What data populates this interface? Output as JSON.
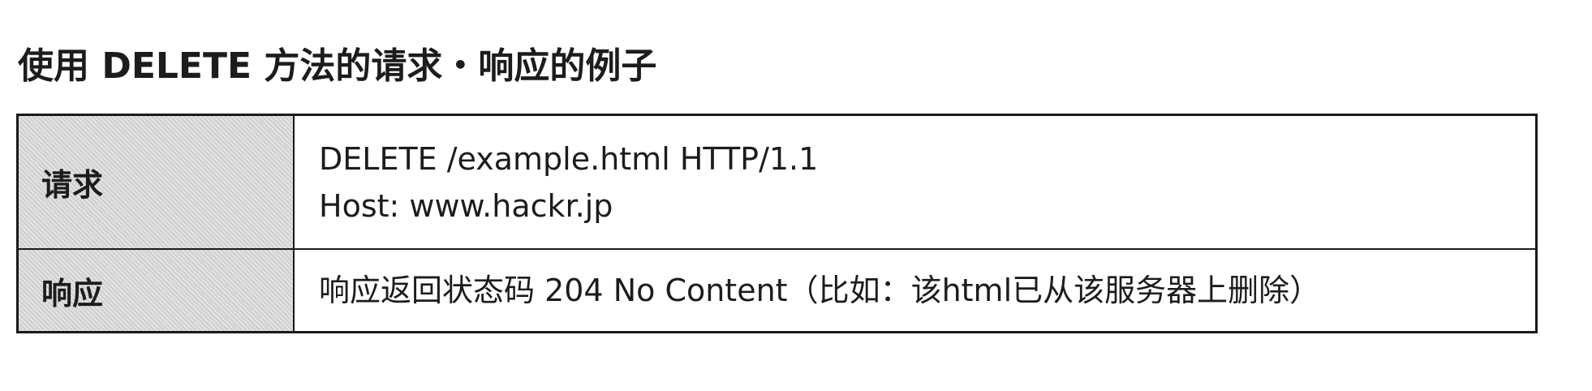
{
  "title": "使用 DELETE 方法的请求・响应的例子",
  "table": {
    "rows": [
      {
        "label": "请求",
        "lines": [
          "DELETE /example.html HTTP/1.1",
          "Host: www.hackr.jp"
        ]
      },
      {
        "label": "响应",
        "lines": [
          "响应返回状态码 204 No Content（比如：该html已从该服务器上删除）"
        ]
      }
    ]
  }
}
